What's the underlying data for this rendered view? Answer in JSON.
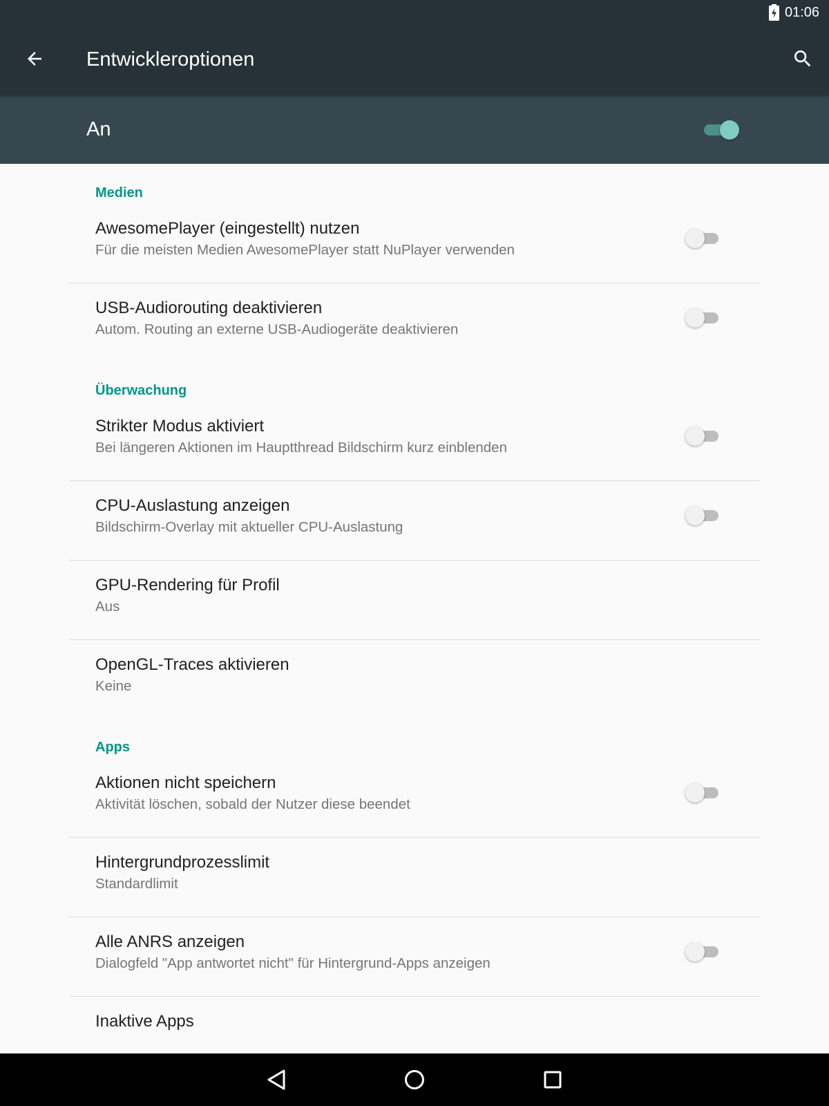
{
  "status_bar": {
    "time": "01:06",
    "battery_icon": "battery-charging-icon"
  },
  "app_bar": {
    "title": "Entwickleroptionen",
    "back_icon": "arrow-back-icon",
    "search_icon": "search-icon"
  },
  "master_switch": {
    "label": "An",
    "checked": true
  },
  "colors": {
    "primary_dark": "#263238",
    "primary": "#37474f",
    "accent": "#009688",
    "switch_on": "#80cbc4"
  },
  "sections": {
    "medien": {
      "header": "Medien"
    },
    "ueberwachung": {
      "header": "Überwachung"
    },
    "apps": {
      "header": "Apps"
    }
  },
  "items": [
    {
      "title": "AwesomePlayer (eingestellt) nutzen",
      "summary": "Für die meisten Medien AwesomePlayer statt NuPlayer verwenden",
      "checked": false
    },
    {
      "title": "USB-Audiorouting deaktivieren",
      "summary": "Autom. Routing an externe USB-Audiogeräte deaktivieren",
      "checked": false
    },
    {
      "title": "Strikter Modus aktiviert",
      "summary": "Bei längeren Aktionen im Hauptthread Bildschirm kurz einblenden",
      "checked": false
    },
    {
      "title": "CPU-Auslastung anzeigen",
      "summary": "Bildschirm-Overlay mit aktueller CPU-Auslastung",
      "checked": false
    },
    {
      "title": "GPU-Rendering für Profil",
      "summary": "Aus"
    },
    {
      "title": "OpenGL-Traces aktivieren",
      "summary": "Keine"
    },
    {
      "title": "Aktionen nicht speichern",
      "summary": "Aktivität löschen, sobald der Nutzer diese beendet",
      "checked": false
    },
    {
      "title": "Hintergrundprozesslimit",
      "summary": "Standardlimit"
    },
    {
      "title": "Alle ANRS anzeigen",
      "summary": "Dialogfeld \"App antwortet nicht\" für Hintergrund-Apps anzeigen",
      "checked": false
    },
    {
      "title": "Inaktive Apps"
    }
  ],
  "nav_bar": {
    "back": "nav-back-icon",
    "home": "nav-home-icon",
    "recents": "nav-recents-icon"
  }
}
